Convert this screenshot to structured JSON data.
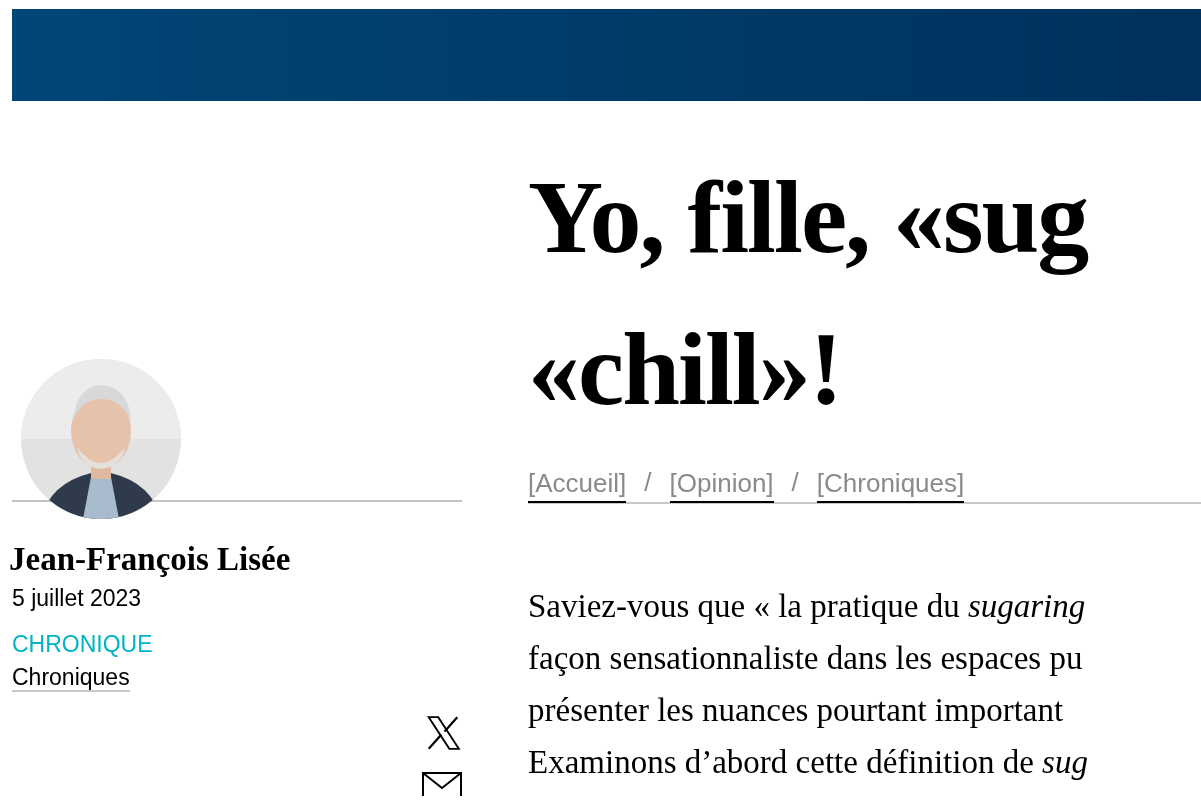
{
  "author": {
    "name": "Jean-François Lisée",
    "date": "5 juillet 2023",
    "category": "CHRONIQUE",
    "section": "Chroniques"
  },
  "share": [
    {
      "kind": "x"
    },
    {
      "kind": "email"
    }
  ],
  "title_lines": [
    "Yo, fille, «sug",
    "«chill»!"
  ],
  "breadcrumb": [
    {
      "label": "[Accueil]"
    },
    {
      "label": "[Opinion]"
    },
    {
      "label": "[Chroniques]"
    }
  ],
  "breadcrumb_separator": "/",
  "body_lines": [
    "Saviez-vous que « la pratique du *sugaring*",
    "façon sensationnaliste dans les espaces pu",
    "présenter les nuances pourtant important",
    "Examinons d’abord cette définition de *sug*"
  ]
}
